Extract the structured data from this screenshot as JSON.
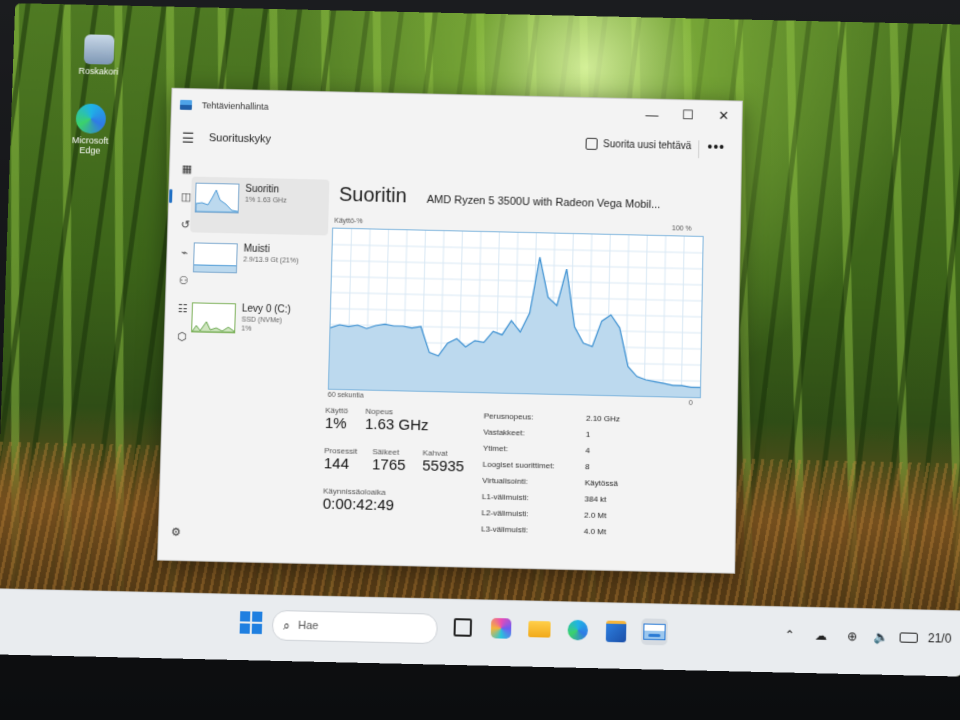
{
  "desktop": {
    "icons": [
      {
        "label": "Roskakori",
        "icon": "recycle-bin-icon"
      },
      {
        "label": "Microsoft Edge",
        "icon": "edge-icon"
      }
    ]
  },
  "window": {
    "title": "Tehtävienhallinta",
    "controls": {
      "minimize": "—",
      "maximize": "☐",
      "close": "✕"
    },
    "header": {
      "page_title": "Suorituskyky",
      "run_task_label": "Suorita uusi tehtävä",
      "more_label": "•••"
    },
    "rail_icons": [
      "menu-icon",
      "processes-icon",
      "performance-icon",
      "app-history-icon",
      "startup-icon",
      "users-icon",
      "details-icon",
      "services-icon",
      "settings-icon"
    ],
    "resources": [
      {
        "name": "Suoritin",
        "sub": "1% 1.63 GHz",
        "color": "#4c9ad6"
      },
      {
        "name": "Muisti",
        "sub": "2.9/13.9 Gt (21%)",
        "color": "#4c9ad6"
      },
      {
        "name": "Levy 0 (C:)",
        "sub": "SSD (NVMe)",
        "sub2": "1%",
        "color": "#6aa84f"
      }
    ],
    "cpu": {
      "title": "Suoritin",
      "model": "AMD Ryzen 5 3500U with Radeon Vega Mobil...",
      "graph_label_top_left": "Käyttö-%",
      "graph_label_top_right": "100 %",
      "graph_label_bottom_left": "60 sekuntia",
      "graph_label_bottom_right": "0",
      "usage_series": [
        38,
        40,
        39,
        40,
        38,
        40,
        41,
        40,
        40,
        39,
        40,
        24,
        22,
        30,
        33,
        28,
        32,
        31,
        38,
        36,
        45,
        38,
        50,
        85,
        60,
        55,
        78,
        42,
        32,
        30,
        46,
        50,
        42,
        18,
        12,
        10,
        9,
        8,
        7,
        7,
        6,
        6
      ]
    },
    "stats": {
      "kaytto_label": "Käyttö",
      "kaytto_value": "1%",
      "nopeus_label": "Nopeus",
      "nopeus_value": "1.63 GHz",
      "prosessit_label": "Prosessit",
      "prosessit_value": "144",
      "saikeet_label": "Säikeet",
      "saikeet_value": "1765",
      "kahvat_label": "Kahvat",
      "kahvat_value": "55935",
      "uptime_label": "Käynnissäoloaika",
      "uptime_value": "0:00:42:49"
    },
    "specs": [
      {
        "key": "Perusnopeus:",
        "value": "2.10 GHz"
      },
      {
        "key": "Vastakkeet:",
        "value": "1"
      },
      {
        "key": "Ytimet:",
        "value": "4"
      },
      {
        "key": "Loogiset suorittimet:",
        "value": "8"
      },
      {
        "key": "Virtualisointi:",
        "value": "Käytössä"
      },
      {
        "key": "L1-välimuisti:",
        "value": "384 kt"
      },
      {
        "key": "L2-välimuisti:",
        "value": "2.0 Mt"
      },
      {
        "key": "L3-välimuisti:",
        "value": "4.0 Mt"
      }
    ]
  },
  "taskbar": {
    "search_placeholder": "Hae",
    "apps": [
      "start-icon",
      "task-view-icon",
      "copilot-icon",
      "file-explorer-icon",
      "edge-icon",
      "microsoft-store-icon",
      "task-manager-icon"
    ],
    "tray": {
      "clock": "21/0"
    },
    "colors": {
      "accent": "#2a7ad5"
    }
  }
}
